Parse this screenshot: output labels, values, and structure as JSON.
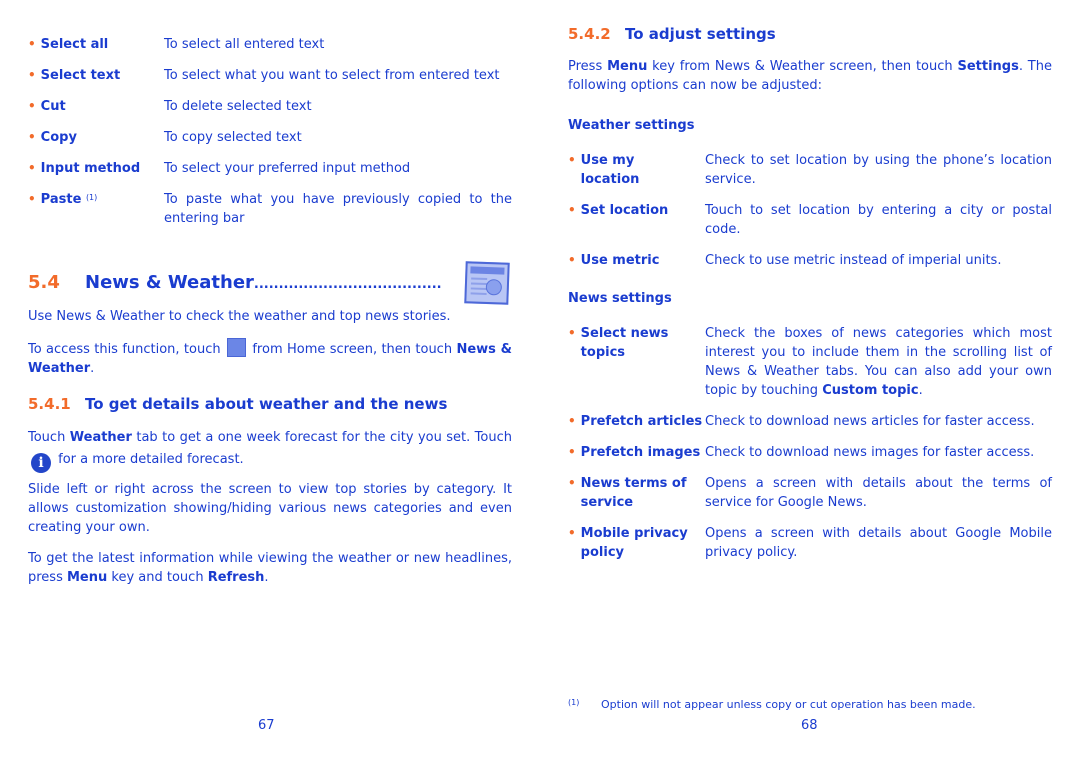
{
  "left_page": {
    "options": [
      {
        "term": "Select all",
        "desc": "To select all entered text"
      },
      {
        "term": "Select text",
        "desc": "To select what you want to select from entered text"
      },
      {
        "term": "Cut",
        "desc": "To delete selected text"
      },
      {
        "term": "Copy",
        "desc": "To copy selected text"
      },
      {
        "term": "Input method",
        "desc": "To select your preferred input method"
      },
      {
        "term": "Paste",
        "sup": "(1)",
        "desc": "To paste what you have previously copied to the entering bar"
      }
    ],
    "section": {
      "number": "5.4",
      "title": "News & Weather",
      "leader": "......................................",
      "icon": "google-news-icon"
    },
    "intro": "Use News & Weather to check the weather and top news stories.",
    "access": {
      "before": "To access this function, touch",
      "icon": "app-grid-icon",
      "after": "from Home screen, then touch",
      "bold": "News & Weather",
      "end": "."
    },
    "subsection": {
      "number": "5.4.1",
      "title": "To get details about weather and the news"
    },
    "p1": {
      "a": "Touch",
      "b_bold": "Weather",
      "c": "tab to get a one week forecast for the city you set. Touch",
      "icon": "info-icon",
      "d": "for a more detailed forecast."
    },
    "p2": "Slide left or right across the screen to view top stories by category. It allows customization showing/hiding various news categories and even creating your own.",
    "p3": {
      "a": "To get the latest information while viewing the weather or new headlines, press",
      "b_bold": "Menu",
      "c": "key and touch",
      "d_bold": "Refresh",
      "e": "."
    },
    "page_number": "67"
  },
  "right_page": {
    "subsection": {
      "number": "5.4.2",
      "title": "To adjust settings"
    },
    "intro": {
      "a": "Press",
      "b_bold": "Menu",
      "c": "key from News & Weather screen, then touch",
      "d_bold": "Settings",
      "e": ". The following options can now be adjusted:"
    },
    "weather_heading": "Weather settings",
    "weather_options": [
      {
        "term": "Use my location",
        "desc": "Check to set location by using the phone’s location service."
      },
      {
        "term": "Set location",
        "desc": "Touch to set location by entering a city or postal code."
      },
      {
        "term": "Use metric",
        "desc": "Check to use metric instead of imperial units."
      }
    ],
    "news_heading": "News settings",
    "news_options": [
      {
        "term": "Select news topics",
        "desc": "Check the boxes of news categories which most interest you to include them in the scrolling list of News & Weather tabs. You can also add your own topic by touching",
        "desc_bold": "Custom topic",
        "desc_end": "."
      },
      {
        "term": "Prefetch articles",
        "desc": "Check to download news articles for faster access."
      },
      {
        "term": "Prefetch images",
        "desc": "Check to download news images for faster access."
      },
      {
        "term": "News terms of service",
        "desc": "Opens a screen with details about the terms of service for Google News."
      },
      {
        "term": "Mobile privacy policy",
        "desc": "Opens a screen with details about Google Mobile privacy policy."
      }
    ],
    "footnote": {
      "mark": "(1)",
      "text": "Option will not appear unless copy or cut operation has been made."
    },
    "page_number": "68"
  },
  "colors": {
    "text": "#1a3ccf",
    "accent": "#f26b2a"
  }
}
